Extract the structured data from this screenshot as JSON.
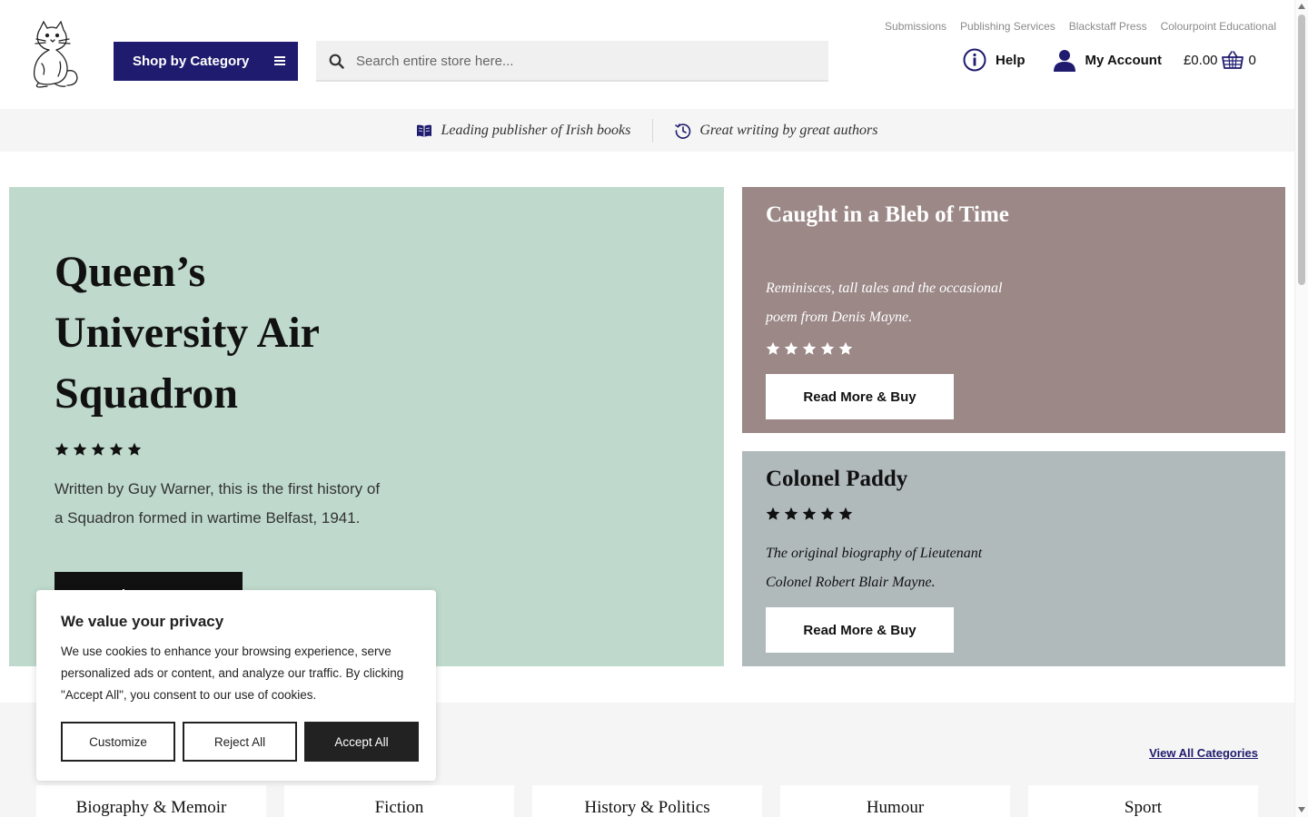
{
  "header": {
    "shop_button_label": "Shop by Category",
    "search_placeholder": "Search entire store here...",
    "top_links": [
      "Submissions",
      "Publishing Services",
      "Blackstaff Press",
      "Colourpoint Educational"
    ],
    "help_label": "Help",
    "account_label": "My Account",
    "cart_total": "£0.00",
    "cart_count": "0"
  },
  "strip": {
    "item1": "Leading publisher of Irish books",
    "item2": "Great writing by great authors"
  },
  "hero": {
    "title": "Queen’s University Air Squadron",
    "rating": 5,
    "description": "Written by Guy Warner, this is the first history of a Squadron formed in wartime Belfast, 1941.",
    "cta_label": "Read More & Buy"
  },
  "cards": [
    {
      "title": "Caught in a Bleb of Time",
      "description": "Reminisces, tall tales and the occasional poem from Denis Mayne.",
      "rating": 5,
      "cta_label": "Read More & Buy"
    },
    {
      "title": "Colonel Paddy",
      "description": "The original biography of Lieutenant Colonel Robert Blair Mayne.",
      "rating": 5,
      "cta_label": "Read More & Buy"
    }
  ],
  "categories": {
    "view_all_label": "View All Categories",
    "tiles": [
      "Biography & Memoir",
      "Fiction",
      "History & Politics",
      "Humour",
      "Sport"
    ]
  },
  "cookie": {
    "title": "We value your privacy",
    "body": "We use cookies to enhance your browsing experience, serve personalized ads or content, and analyze our traffic. By clicking \"Accept All\", you consent to our use of cookies.",
    "customize_label": "Customize",
    "reject_label": "Reject All",
    "accept_label": "Accept All"
  },
  "colors": {
    "brand_navy": "#1f1b6e",
    "hero_bg": "#bfdacd",
    "card1_bg": "#9b8887",
    "card2_bg": "#b1babb"
  }
}
